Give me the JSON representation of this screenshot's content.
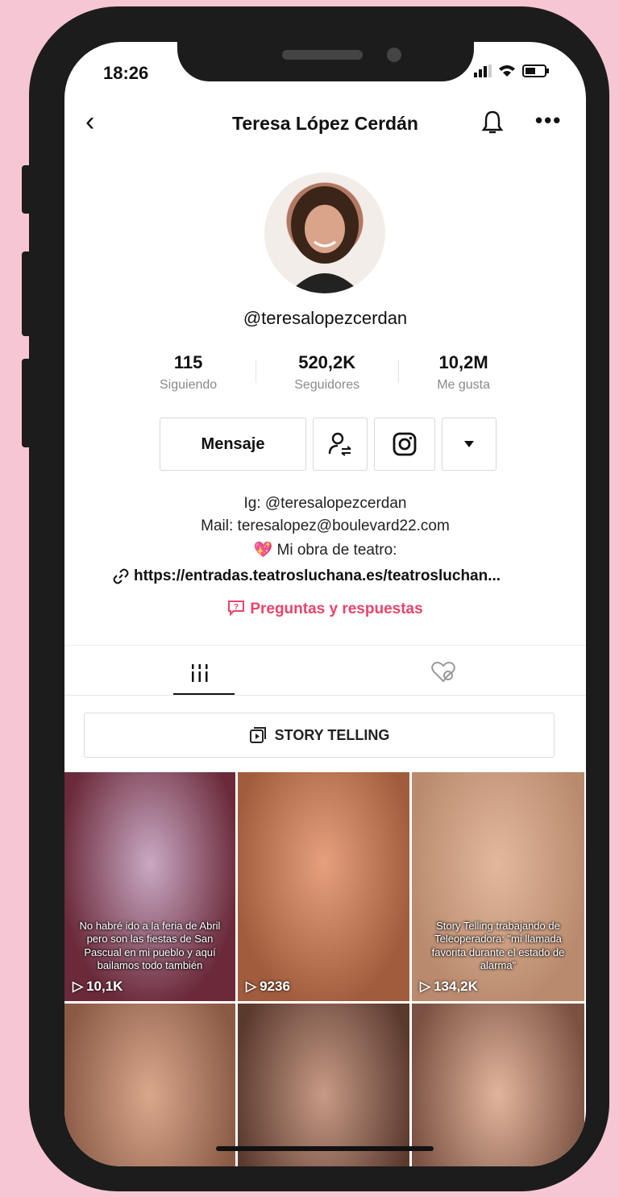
{
  "status_bar": {
    "time": "18:26"
  },
  "header": {
    "title": "Teresa López Cerdán"
  },
  "profile": {
    "handle": "@teresalopezcerdan",
    "stats": [
      {
        "value": "115",
        "label": "Siguiendo"
      },
      {
        "value": "520,2K",
        "label": "Seguidores"
      },
      {
        "value": "10,2M",
        "label": "Me gusta"
      }
    ],
    "message_button": "Mensaje",
    "bio_lines": [
      "Ig: @teresalopezcerdan",
      "Mail: teresalopez@boulevard22.com",
      "Mi obra de teatro:"
    ],
    "bio_emoji": "💖",
    "link": "https://entradas.teatrosluchana.es/teatrosluchan...",
    "qa": "Preguntas y respuestas"
  },
  "playlist": {
    "label": "STORY TELLING"
  },
  "videos": [
    {
      "caption": "No habré ido a la feria de Abril pero son las fiestas de San Pascual en mi pueblo y aquí bailamos todo también",
      "views": "10,1K",
      "colors": [
        "#6b2a3a",
        "#c9a9c4"
      ]
    },
    {
      "caption": "",
      "views": "9236",
      "colors": [
        "#a05c3c",
        "#e6a07e"
      ]
    },
    {
      "caption": "Story Telling trabajando de Teleoperadora: \"mi llamada favorita durante el estado de alarma\"",
      "views": "134,2K",
      "colors": [
        "#b98a6e",
        "#e2b89c"
      ]
    },
    {
      "caption": "",
      "views": "",
      "colors": [
        "#8a5a45",
        "#d9a78b"
      ]
    },
    {
      "caption": "",
      "views": "",
      "colors": [
        "#5b3a2e",
        "#c79a86"
      ]
    },
    {
      "caption": "",
      "views": "",
      "colors": [
        "#7a5142",
        "#e1b59c"
      ]
    }
  ],
  "colors": {
    "accent": "#e8446b",
    "background": "#f7c6d4"
  }
}
